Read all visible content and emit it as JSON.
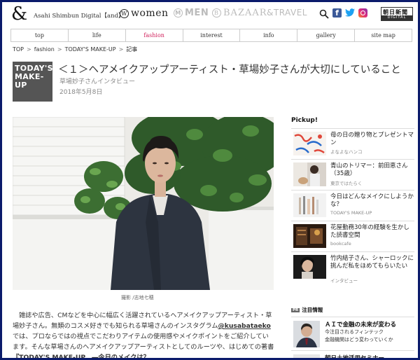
{
  "header": {
    "logo": "&",
    "site_name": "Asahi Shimbun Digital【and】",
    "brands": {
      "women_icon": "W",
      "women": "women",
      "men_icon": "M",
      "men": "MEN",
      "bazaar_icon": "B",
      "bazaar": "BAZAAR",
      "travel": "&TRAVEL"
    },
    "icons": [
      "search-icon",
      "facebook-icon",
      "twitter-icon",
      "instagram-icon"
    ],
    "facebook_letter": "f",
    "asahi_top": "朝日新聞",
    "asahi_bottom": "DIGITAL"
  },
  "nav": {
    "items": [
      "top",
      "life",
      "fashion",
      "interest",
      "info",
      "gallery",
      "site map"
    ],
    "active": "fashion",
    "active_color": "#d0205b"
  },
  "breadcrumb": {
    "items": [
      "TOP",
      "fashion",
      "TODAY'S MAKE-UP",
      "記事"
    ],
    "separator": ">"
  },
  "article": {
    "cover_line1": "TODAY'S",
    "cover_line2": "MAKE-",
    "cover_line3": "UP",
    "title": "＜１＞ヘアメイクアップアーティスト・草場妙子さんが大切にしていること",
    "subtitle": "草場妙子さんインタビュー",
    "date": "2018年5月8日",
    "caption": "撮影 /志地七穂",
    "body_part1": "雑誌や広告、CMなどを中心に幅広く活躍されているヘアメイクアップアーティスト・草場妙子さん。無類のコスメ好きでも知られる草場さんのインスタグラム",
    "body_handle": "@kusabataeko",
    "body_part2": "では、プロならではの視点でこだわりアイテムの使用感やメイクポイントをご紹介しています。そんな草場さんのヘアメイクアップアーティストとしてのルーツや、はじめての著書",
    "body_bold": "『TODAY'S MAKE-UP　―今日のメイクは？"
  },
  "sidebar": {
    "pickup_title": "Pickup!",
    "pickups": [
      {
        "title": "母の日の贈り物とプレゼントマン",
        "sub": "よなよなハンコ"
      },
      {
        "title": "青山のトリマー：前田恵さん（35歳）",
        "sub": "東京ではたらく"
      },
      {
        "title": "今日はどんなメイクにしようかな？",
        "sub": "TODAY'S MAKE-UP"
      },
      {
        "title": "花屋勤務30年の経験を生かした読書空間",
        "sub": "bookcafe"
      },
      {
        "title": "竹内結子さん、シャーロックに挑んだ私をほめてもらいたい",
        "sub": "インタビュー"
      }
    ],
    "attention": {
      "badge": "PR",
      "title": "注目情報",
      "items": [
        {
          "title": "ＡＩで金融の未来が変わる",
          "line1": "今注目されるフィンテック",
          "line2": "金融機関はどう変わっていくか"
        },
        {
          "title": "朝日土地活用セミナー",
          "line1": "",
          "line2": ""
        }
      ]
    }
  }
}
